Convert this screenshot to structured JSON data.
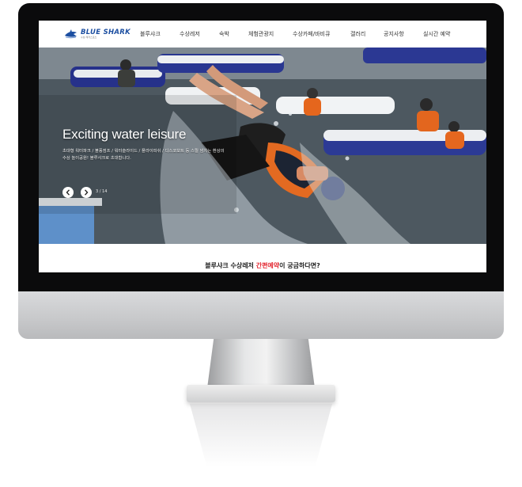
{
  "brand": {
    "name": "BLUE SHARK",
    "tagline": "수상 레저스포츠",
    "color": "#1d4fa1"
  },
  "nav": {
    "items": [
      "블루샤크",
      "수상레저",
      "숙박",
      "체험관광지",
      "수상카페/바비큐",
      "갤러리",
      "공지사항",
      "실시간 예약"
    ]
  },
  "hero": {
    "title": "Exciting water leisure",
    "description": "초대형 워터파크 / 볼풍점프 / 워터슬라이드 / 플라이피쉬 / 디스코보트 등 스릴 넘치는 환상의 수상 놀이공원! 블루샤크로 초대합니다.",
    "counter": "3 / 14",
    "prev_icon": "chevron-left-icon",
    "next_icon": "chevron-right-icon"
  },
  "cta": {
    "before": "블루샤크 수상레저 ",
    "highlight": "간편예약",
    "after": "이 궁금하다면?",
    "highlight_color": "#e3262f"
  }
}
